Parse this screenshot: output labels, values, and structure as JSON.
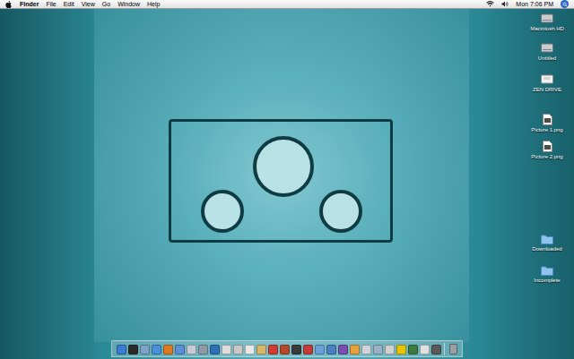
{
  "menu_bar": {
    "app": "Finder",
    "menus": [
      "File",
      "Edit",
      "View",
      "Go",
      "Window",
      "Help"
    ],
    "clock": "Mon 7:06 PM"
  },
  "desktop_icons": [
    {
      "label": "Macintosh HD",
      "kind": "drive"
    },
    {
      "label": "Untitled",
      "kind": "drive"
    },
    {
      "label": "ZEN DRIVE",
      "kind": "removable"
    },
    {
      "label": "Picture 1.png",
      "kind": "file"
    },
    {
      "label": "Picture 2.png",
      "kind": "file"
    },
    {
      "label": "Downloaded",
      "kind": "folder"
    },
    {
      "label": "Incomplete",
      "kind": "folder"
    }
  ],
  "dock": {
    "items": [
      {
        "kind": "app",
        "color": "#3b7bd0"
      },
      {
        "kind": "app",
        "color": "#2b2b2b"
      },
      {
        "kind": "app",
        "color": "#7fa2c8"
      },
      {
        "kind": "app",
        "color": "#4a90d9"
      },
      {
        "kind": "app",
        "color": "#e07a20"
      },
      {
        "kind": "app",
        "color": "#5b8fd6"
      },
      {
        "kind": "app",
        "color": "#c7ccd4"
      },
      {
        "kind": "app",
        "color": "#8e9aa8"
      },
      {
        "kind": "app",
        "color": "#2f6fb8"
      },
      {
        "kind": "app",
        "color": "#dcdcdc"
      },
      {
        "kind": "app",
        "color": "#c9c9c9"
      },
      {
        "kind": "app",
        "color": "#e8e8e8"
      },
      {
        "kind": "app",
        "color": "#d8b76a"
      },
      {
        "kind": "app",
        "color": "#d23b2f"
      },
      {
        "kind": "app",
        "color": "#b54a2a"
      },
      {
        "kind": "app",
        "color": "#3a3a3a"
      },
      {
        "kind": "app",
        "color": "#c23a3a"
      },
      {
        "kind": "app",
        "color": "#6aa0d8"
      },
      {
        "kind": "app",
        "color": "#4b7fc0"
      },
      {
        "kind": "app",
        "color": "#7a4fb0"
      },
      {
        "kind": "app",
        "color": "#e6a13a"
      },
      {
        "kind": "app",
        "color": "#cfd4da"
      },
      {
        "kind": "app",
        "color": "#9ab0c6"
      },
      {
        "kind": "app",
        "color": "#d0d0d0"
      },
      {
        "kind": "app",
        "color": "#e8c400"
      },
      {
        "kind": "app",
        "color": "#3d7a3d"
      },
      {
        "kind": "app",
        "color": "#e0e0e0"
      },
      {
        "kind": "app",
        "color": "#5a5a5a"
      },
      {
        "kind": "trash",
        "color": "#9aa0a6"
      }
    ]
  }
}
